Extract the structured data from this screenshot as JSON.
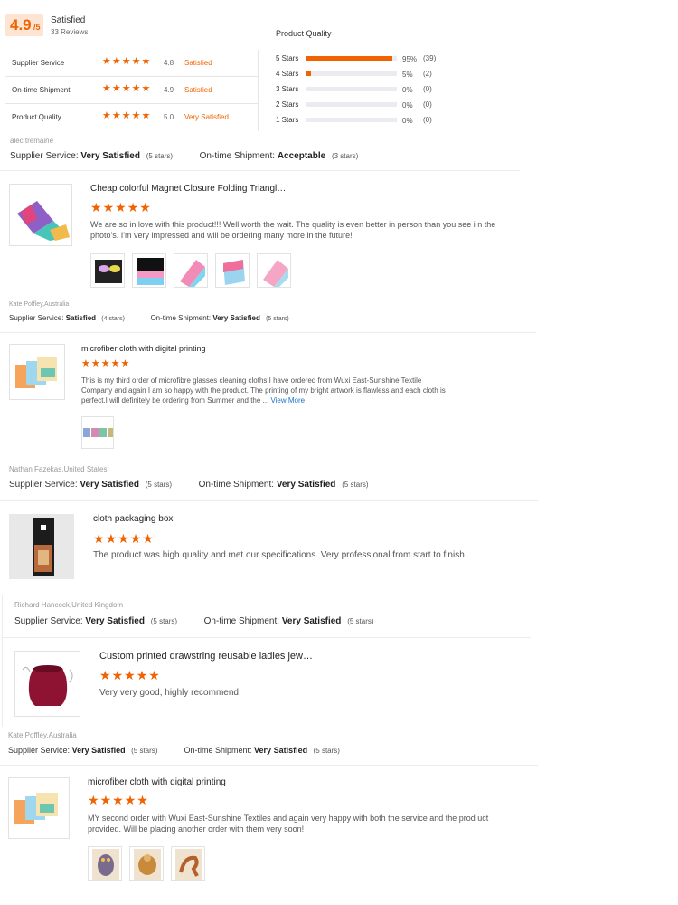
{
  "summary": {
    "score": "4.9",
    "score_max": "/5",
    "status": "Satisfied",
    "reviews": "33 Reviews",
    "metrics": [
      {
        "label": "Supplier Service",
        "stars": 5,
        "value": "4.8",
        "status": "Satisfied"
      },
      {
        "label": "On-time Shipment",
        "stars": 5,
        "value": "4.9",
        "status": "Satisfied"
      },
      {
        "label": "Product Quality",
        "stars": 5,
        "value": "5.0",
        "status": "Very Satisfied"
      }
    ],
    "histogram": {
      "title": "Product Quality",
      "rows": [
        {
          "label": "5 Stars",
          "fraction": 0.95,
          "pct": "95%",
          "count": "(39)"
        },
        {
          "label": "4 Stars",
          "fraction": 0.05,
          "pct": "5%",
          "count": "(2)"
        },
        {
          "label": "3 Stars",
          "fraction": 0.0,
          "pct": "0%",
          "count": "(0)"
        },
        {
          "label": "2 Stars",
          "fraction": 0.0,
          "pct": "0%",
          "count": "(0)"
        },
        {
          "label": "1 Stars",
          "fraction": 0.0,
          "pct": "0%",
          "count": "(0)"
        }
      ]
    }
  },
  "labels": {
    "supplier_service": "Supplier Service:",
    "ontime_shipment": "On-time Shipment:",
    "view_more": "View More"
  },
  "reviews": [
    {
      "reviewer": "alec tremaine",
      "supplier_rating": "Very Satisfied",
      "supplier_stars": "(5 stars)",
      "shipment_rating": "Acceptable",
      "shipment_stars": "(3 stars)",
      "product": "Cheap colorful Magnet Closure Folding Triangl…",
      "stars": 5,
      "text": "We are so in love with this product!!! Well worth the wait. The quality is even better in person than you see i n the photo's. I'm very impressed and will be ordering many more in the future!"
    },
    {
      "reviewer": "Kate Poffley,Australia",
      "supplier_rating": "Satisfied",
      "supplier_stars": "(4 stars)",
      "shipment_rating": "Very Satisfied",
      "shipment_stars": "(5 stars)",
      "product": "microfiber cloth with digital printing",
      "stars": 5,
      "text": "This is my third order of microfibre glasses cleaning cloths I have ordered from Wuxi East-Sunshine Textile Company and again I am so happy with the product. The printing of my bright artwork is flawless and each cloth is perfect.I will definitely be ordering from Summer and the ..."
    },
    {
      "reviewer": "Nathan Fazekas,United States",
      "supplier_rating": "Very Satisfied",
      "supplier_stars": "(5 stars)",
      "shipment_rating": "Very Satisfied",
      "shipment_stars": "(5 stars)",
      "product": "cloth packaging box",
      "stars": 5,
      "text": "The product was high quality and met our specifications. Very professional from start to finish."
    },
    {
      "reviewer": "Richard Hancock,United Kingdom",
      "supplier_rating": "Very Satisfied",
      "supplier_stars": "(5 stars)",
      "shipment_rating": "Very Satisfied",
      "shipment_stars": "(5 stars)",
      "product": "Custom printed drawstring reusable ladies jew…",
      "stars": 5,
      "text": "Very very good, highly recommend."
    },
    {
      "reviewer": "Kate Poffley,Australia",
      "supplier_rating": "Very Satisfied",
      "supplier_stars": "(5 stars)",
      "shipment_rating": "Very Satisfied",
      "shipment_stars": "(5 stars)",
      "product": "microfiber cloth with digital printing",
      "stars": 5,
      "text": "MY second order with Wuxi East-Sunshine Textiles and again very happy with both the service and the prod uct provided. Will be placing another order with them very soon!"
    }
  ],
  "colors": {
    "accent": "#f06300",
    "link": "#1a73c9"
  }
}
